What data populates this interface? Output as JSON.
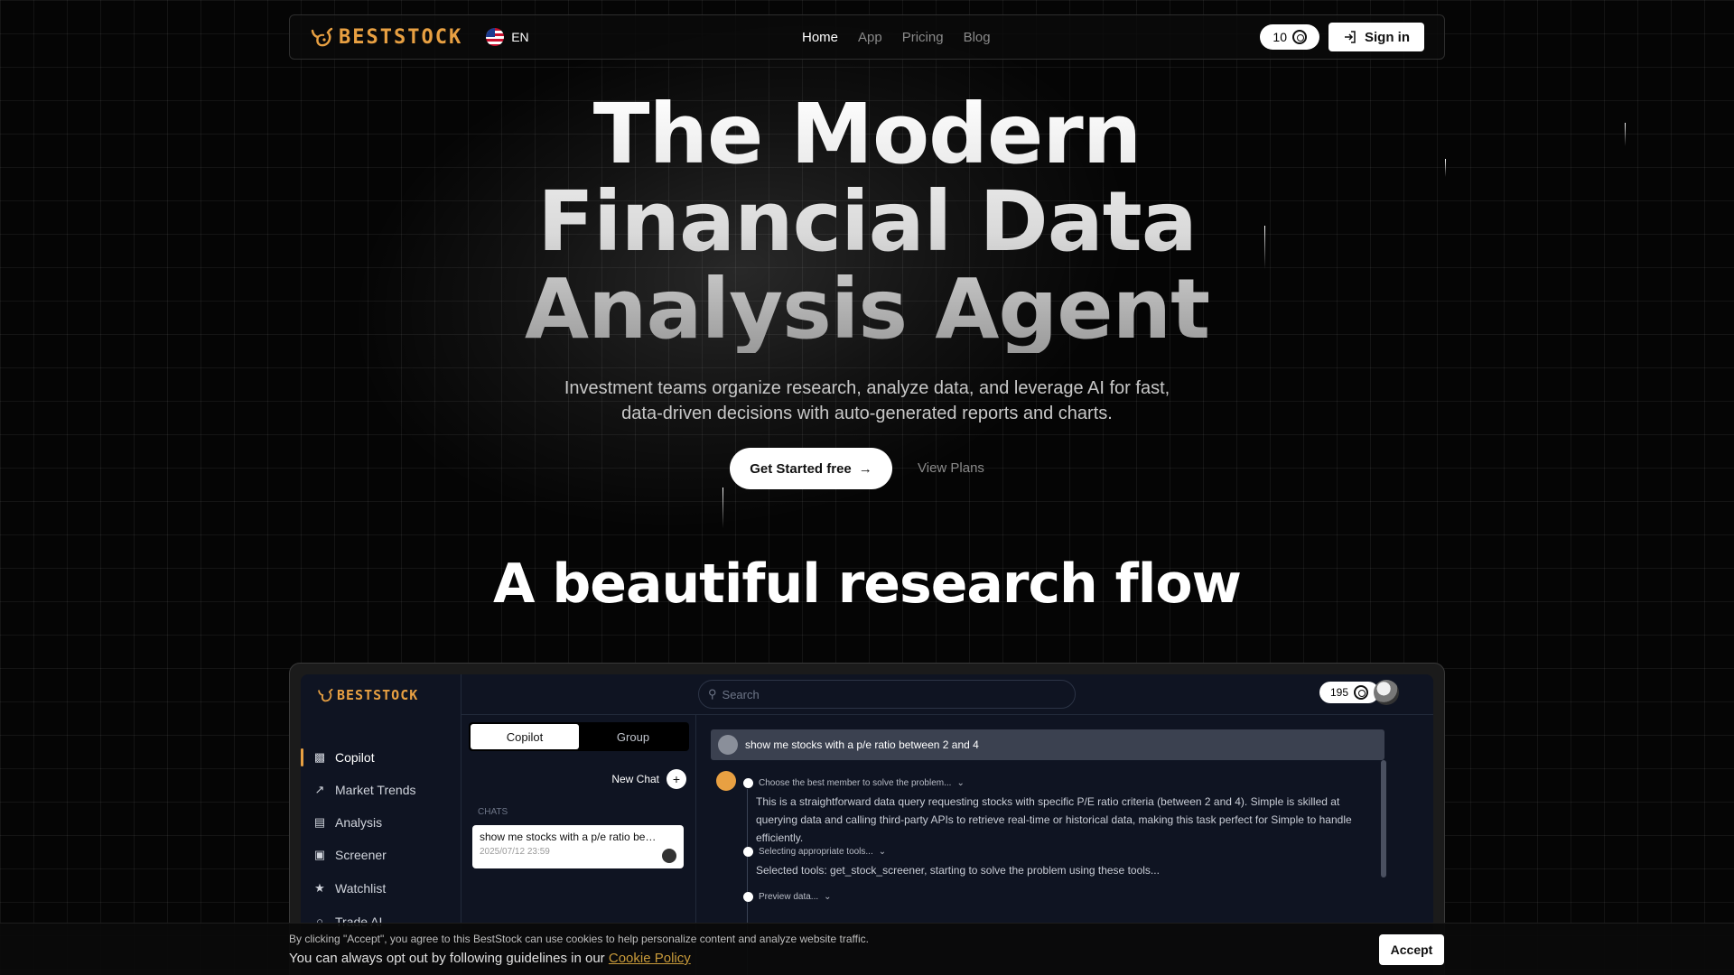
{
  "brand": {
    "name": "BESTSTOCK",
    "color": "#e8a042"
  },
  "nav": {
    "language": "EN",
    "links": [
      {
        "label": "Home",
        "active": true
      },
      {
        "label": "App",
        "active": false
      },
      {
        "label": "Pricing",
        "active": false
      },
      {
        "label": "Blog",
        "active": false
      }
    ],
    "credits": "10",
    "sign_in": "Sign in"
  },
  "hero": {
    "title_lines": [
      "The Modern",
      "Financial Data",
      "Analysis Agent"
    ],
    "subtitle_lines": [
      "Investment teams organize research, analyze data, and leverage AI for fast,",
      "data-driven decisions with auto-generated reports and charts."
    ],
    "cta_primary": "Get Started free",
    "cta_secondary": "View Plans"
  },
  "section": {
    "title": "A beautiful research flow"
  },
  "app_preview": {
    "logo": "BESTSTOCK",
    "search_placeholder": "Search",
    "credits": "195",
    "sidebar": [
      {
        "label": "Copilot",
        "icon": "chat-icon",
        "active": true
      },
      {
        "label": "Market Trends",
        "icon": "trend-icon",
        "active": false
      },
      {
        "label": "Analysis",
        "icon": "chart-icon",
        "active": false
      },
      {
        "label": "Screener",
        "icon": "screener-icon",
        "active": false
      },
      {
        "label": "Watchlist",
        "icon": "star-icon",
        "active": false
      },
      {
        "label": "Trade AI",
        "icon": "robot-icon",
        "active": false
      }
    ],
    "tabs": [
      "Copilot",
      "Group"
    ],
    "new_chat": "New Chat",
    "chats_label": "CHATS",
    "chat_item": {
      "title": "show me stocks with a p/e ratio betwee...",
      "date": "2025/07/12 23:59"
    },
    "user_message": "show me stocks with a p/e ratio between 2 and 4",
    "steps": [
      {
        "title": "Choose the best member to solve the problem...",
        "body": "This is a straightforward data query requesting stocks with specific P/E ratio criteria (between 2 and 4). Simple is skilled at querying data and calling third-party APIs to retrieve real-time or historical data, making this task perfect for Simple to handle efficiently."
      },
      {
        "title": "Selecting appropriate tools...",
        "body": "Selected tools: get_stock_screener, starting to solve the problem using these tools..."
      },
      {
        "title": "Preview data...",
        "body": ""
      }
    ]
  },
  "cookie": {
    "line1": "By clicking \"Accept\", you agree to this BestStock can use cookies to help personalize content and analyze website traffic.",
    "line2": "You can always opt out by following guidelines in our",
    "link": "Cookie Policy",
    "accept": "Accept"
  }
}
